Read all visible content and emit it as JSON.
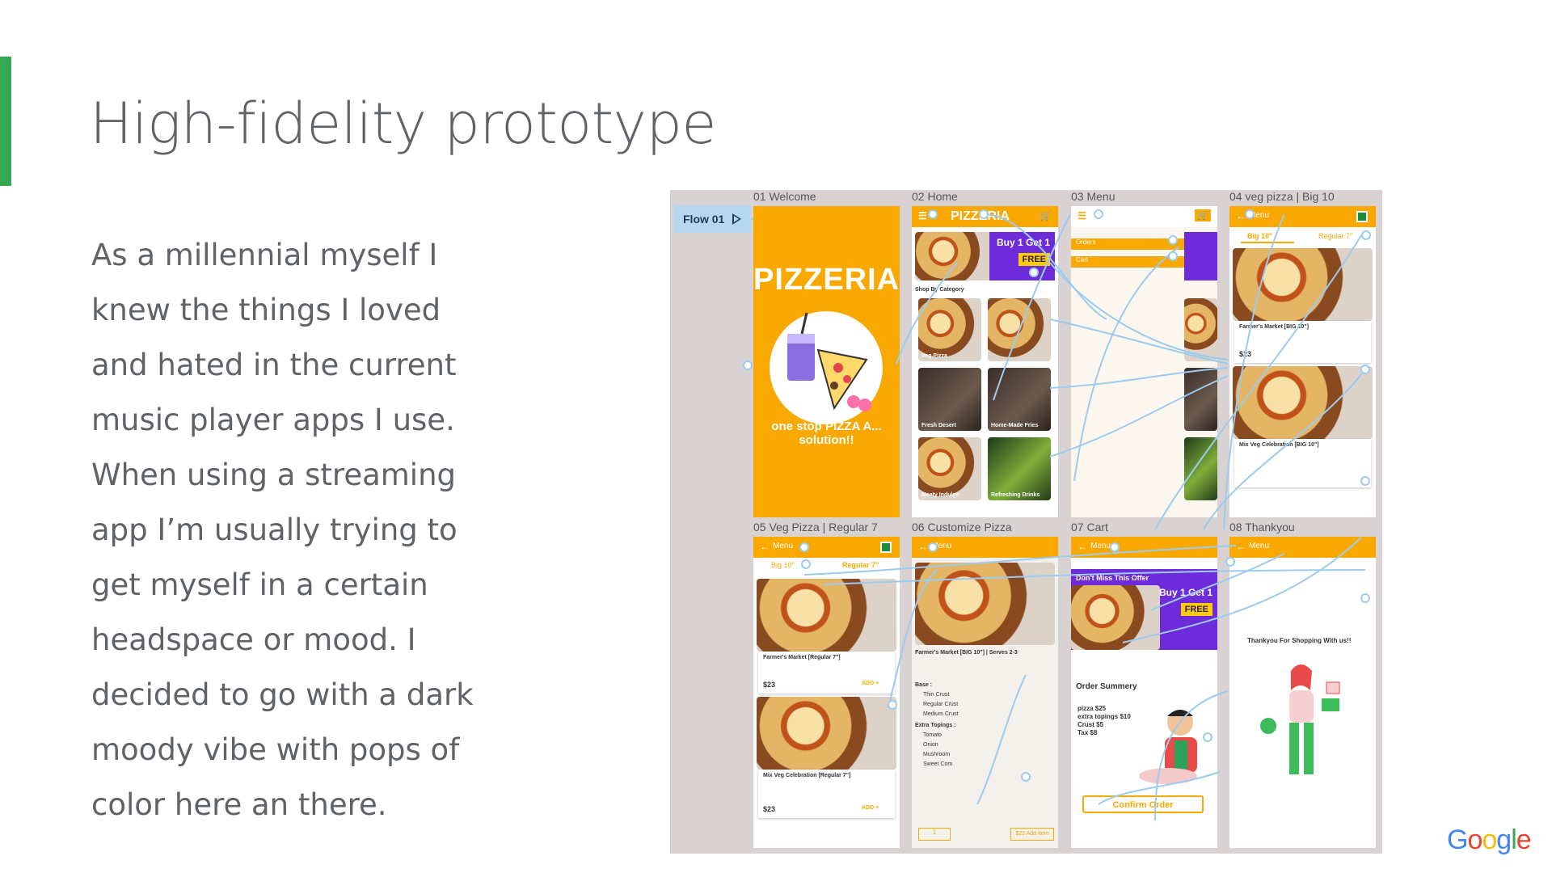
{
  "slide": {
    "title": "High-fidelity prototype",
    "body_lines": [
      "As a millennial myself I",
      "knew the things I loved",
      "and hated in the current",
      "music player apps I use.",
      "When using a streaming",
      "app I’m usually trying to",
      "get myself in a certain",
      "headspace or mood. I",
      "decided to go with a dark",
      "moody vibe with pops of",
      "color here an there."
    ],
    "accent_color": "#34a853"
  },
  "prototype": {
    "flow_label": "Flow 01",
    "frames": [
      "01 Welcome",
      "02 Home",
      "03 Menu",
      "04 veg pizza | Big 10",
      "05 Veg Pizza | Regular 7",
      "06 Customize Pizza",
      "07 Cart",
      "08 Thankyou"
    ],
    "welcome": {
      "brand": "PIZZERIA",
      "tagline": "one stop PIZZA A... solution!!"
    },
    "home": {
      "header": "PIZZERIA",
      "section": "Shop By Category",
      "offer_top": "Buy 1 Get 1",
      "offer_free": "FREE",
      "tiles": [
        "Veg Pizza",
        "Fresh Desert",
        "Home-Made Fries",
        "Meaty Indulge",
        "Refreshing Drinks"
      ]
    },
    "menu": {
      "items": [
        "Orders",
        "Cart"
      ]
    },
    "veg_big": {
      "tabs": [
        "Big 10\"",
        "Regular 7\""
      ],
      "item1": "Farmer's Market [BIG 10\"]",
      "item2": "Mix Veg Celebration [BIG 10\"]",
      "price": "$23",
      "back": "Menu"
    },
    "veg_regular": {
      "tabs": [
        "Big 10\"",
        "Regular 7\""
      ],
      "item1": "Farmer's Market [Regular 7\"]",
      "item2": "Mix Veg Celebration [Regular 7\"]",
      "price": "$23",
      "add": "ADD +",
      "back": "Menu"
    },
    "customize": {
      "item": "Farmer's Market [BIG 10\"] | Serves 2-3",
      "base_label": "Base :",
      "bases": [
        "Thin Crust",
        "Regular Crust",
        "Medium Crust"
      ],
      "toppings_label": "Extra Topings :",
      "toppings": [
        "Tomato",
        "Onion",
        "Mushroom",
        "Sweet Corn"
      ],
      "qty": "1",
      "add_btn": "$23 Add Item",
      "back": "Menu"
    },
    "cart": {
      "offer": "Don't Miss This Offer",
      "summary_title": "Order Summery",
      "lines": [
        "pizza  $25",
        "extra topings $10",
        "Crust $5",
        "Tax $8"
      ],
      "confirm": "Confirm Order",
      "back": "Menu"
    },
    "thankyou": {
      "message": "Thankyou For Shopping With us!!",
      "back": "Menu"
    }
  },
  "logo": {
    "text": "Google"
  }
}
